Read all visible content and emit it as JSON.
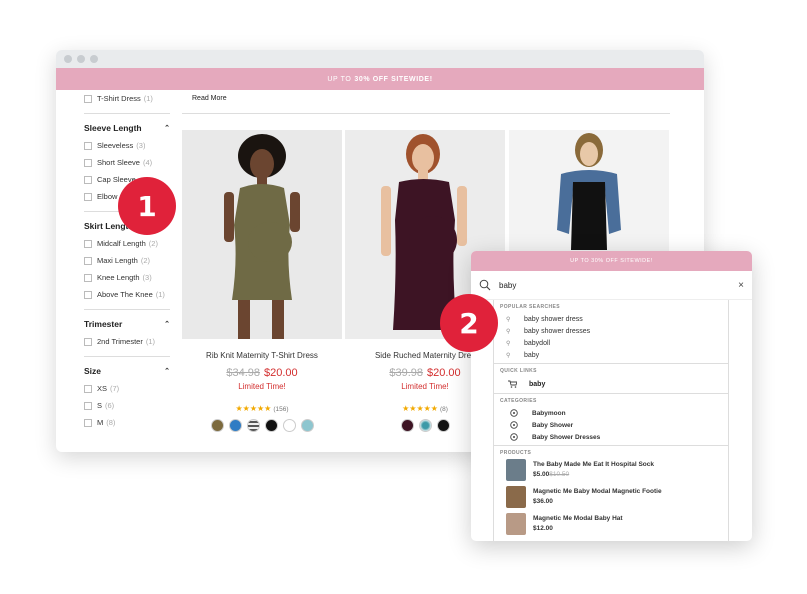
{
  "promo_banner": {
    "prefix": "UP TO",
    "offer": "30% OFF SITEWIDE!"
  },
  "sidebar": {
    "top_item": {
      "label": "T-Shirt Dress",
      "count": "(1)"
    },
    "sections": [
      {
        "title": "Sleeve Length",
        "items": [
          {
            "label": "Sleeveless",
            "count": "(3)"
          },
          {
            "label": "Short Sleeve",
            "count": "(4)"
          },
          {
            "label": "Cap Sleeve",
            "count": ""
          },
          {
            "label": "Elbow",
            "count": ""
          }
        ]
      },
      {
        "title": "Skirt Length",
        "items": [
          {
            "label": "Midcalf Length",
            "count": "(2)"
          },
          {
            "label": "Maxi Length",
            "count": "(2)"
          },
          {
            "label": "Knee Length",
            "count": "(3)"
          },
          {
            "label": "Above The Knee",
            "count": "(1)"
          }
        ]
      },
      {
        "title": "Trimester",
        "items": [
          {
            "label": "2nd Trimester",
            "count": "(1)"
          }
        ]
      },
      {
        "title": "Size",
        "items": [
          {
            "label": "XS",
            "count": "(7)"
          },
          {
            "label": "S",
            "count": "(6)"
          },
          {
            "label": "M",
            "count": "(8)"
          }
        ]
      }
    ]
  },
  "content": {
    "read_more": "Read More"
  },
  "products": [
    {
      "name": "Rib Knit Maternity T-Shirt Dress",
      "was": "$34.98",
      "now": "$20.00",
      "promo": "Limited Time!",
      "stars": "★★★★★",
      "reviews": "(156)",
      "swatches": [
        "#7c6a3e",
        "#2f7cc4",
        "#9a9a9a",
        "#111111",
        "#ffffff",
        "#8ec6cf"
      ]
    },
    {
      "name": "Side Ruched Maternity Dres",
      "was": "$39.98",
      "now": "$20.00",
      "promo": "Limited Time!",
      "stars": "★★★★★",
      "reviews": "(8)",
      "swatches": [
        "#3d1424",
        "#3d9aa8",
        "#111111"
      ]
    }
  ],
  "badges": {
    "one": "1",
    "two": "2"
  },
  "search": {
    "banner": "UP TO 30% OFF SITEWIDE!",
    "query": "baby",
    "close": "×",
    "popular_header": "POPULAR SEARCHES",
    "popular": [
      "baby shower dress",
      "baby shower dresses",
      "babydoll",
      "baby"
    ],
    "quick_header": "QUICK LINKS",
    "quick": [
      "baby"
    ],
    "categories_header": "CATEGORIES",
    "categories": [
      "Babymoon",
      "Baby Shower",
      "Baby Shower Dresses"
    ],
    "products_header": "PRODUCTS",
    "products": [
      {
        "name": "The Baby Made Me Eat It Hospital Sock",
        "price": "$5.00",
        "was": "$10.50",
        "color": "#6b7d8a"
      },
      {
        "name": "Magnetic Me Baby Modal Magnetic Footie",
        "price": "$36.00",
        "was": "",
        "color": "#8a6a4a"
      },
      {
        "name": "Magnetic Me Modal Baby Hat",
        "price": "$12.00",
        "was": "",
        "color": "#b89a86"
      }
    ]
  }
}
